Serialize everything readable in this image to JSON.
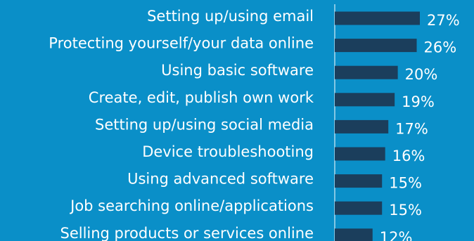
{
  "chart_data": {
    "type": "bar",
    "orientation": "horizontal",
    "title": "",
    "xlabel": "",
    "ylabel": "",
    "categories": [
      "Setting up/using email",
      "Protecting yourself/your data online",
      "Using basic software",
      "Create, edit, publish own work",
      "Setting up/using social media",
      "Device troubleshooting",
      "Using advanced software",
      "Job searching online/applications",
      "Selling products or services online"
    ],
    "values": [
      27,
      26,
      20,
      19,
      17,
      16,
      15,
      15,
      12
    ],
    "value_labels": [
      "27%",
      "26%",
      "20%",
      "19%",
      "17%",
      "16%",
      "15%",
      "15%",
      "12%"
    ],
    "xlim": [
      0,
      27
    ],
    "grid": false,
    "legend": "none"
  },
  "colors": {
    "background": "#0a8fc8",
    "bar": "#1b3e5c",
    "text": "#ffffff",
    "axis": "#ffffff"
  }
}
